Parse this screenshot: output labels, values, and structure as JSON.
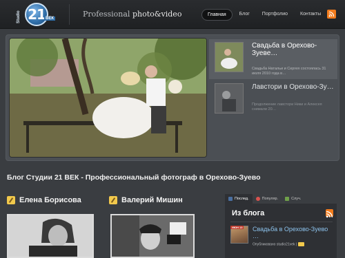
{
  "header": {
    "logo": {
      "number": "21",
      "studio": "Studio",
      "vek": "ВЕК"
    },
    "tagline_plain": "Professional ",
    "tagline_bold": "photo&video",
    "nav": [
      "Главная",
      "Блог",
      "Портфолио",
      "Контакты"
    ],
    "nav_active_index": 0,
    "rss_icon": "rss-icon"
  },
  "slider": {
    "items": [
      {
        "title": "Свадьба в Орехово-Зуеве…",
        "text": "Свадьба Натальи и Сергея состоялась 31 июля 2010 года в…"
      },
      {
        "title": "Лавстори в Орехово-Зу…",
        "text": "Продолжение лавстори Ники и Алексея снимали 20…"
      }
    ]
  },
  "page_title": "Блог Студии 21 ВЕК - Профессиональный фотограф в Орехово-Зуево",
  "authors": [
    {
      "name": "Елена Борисова"
    },
    {
      "name": "Валерий Мишин"
    }
  ],
  "sidebar": {
    "tabs": [
      "Послед.",
      "Популяр.",
      "Случ."
    ],
    "active_tab": 0,
    "tab_colors": [
      "#4a6fa0",
      "#d9534f",
      "#6fa04a"
    ],
    "blog_title": "Из блога",
    "post": {
      "date": "ИЮН 13",
      "title": "Свадьба в Орехово-Зуево …",
      "meta": "Опубликовано studio21vek |"
    }
  },
  "colors": {
    "accent_orange": "#f27b1c",
    "link_blue": "#8cc2ec",
    "background": "#3a3d41"
  }
}
